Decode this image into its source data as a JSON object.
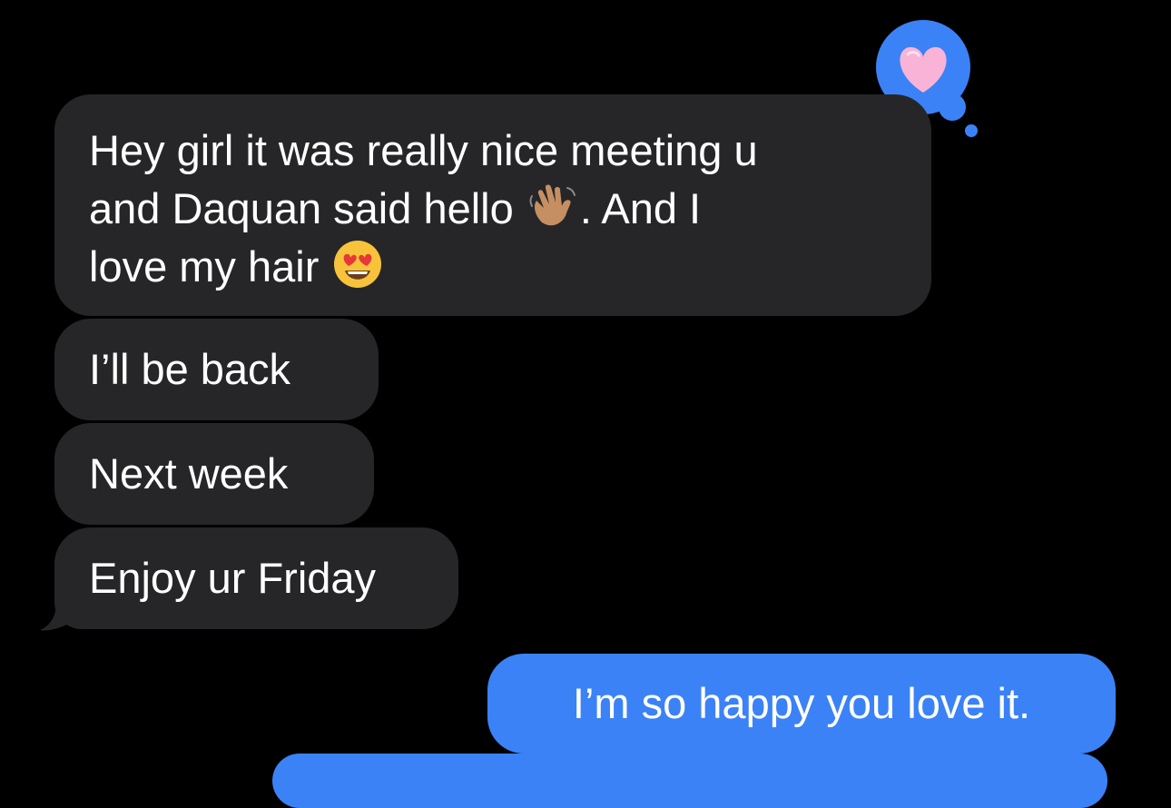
{
  "messages": [
    {
      "direction": "incoming",
      "line1": "Hey girl it was really nice meeting u",
      "line2_before_emoji": "and Daquan said hello",
      "emoji_1": "waving-hand-medium-skin-tone",
      "line2_after_emoji": ". And I",
      "line3_before_emoji": "love my hair",
      "emoji_2": "smiling-face-with-heart-eyes",
      "tapback": "pink-heart"
    },
    {
      "direction": "incoming",
      "text": "I’ll be back"
    },
    {
      "direction": "incoming",
      "text": "Next week"
    },
    {
      "direction": "incoming",
      "text": "Enjoy ur Friday"
    },
    {
      "direction": "outgoing",
      "text": "I’m so happy you love it."
    }
  ],
  "colors": {
    "background": "#000000",
    "incoming_bubble": "#262629",
    "outgoing_bubble": "#3b82f6",
    "tapback_bubble": "#3b82f6",
    "heart": "#f9b3d6",
    "text": "#ffffff"
  }
}
